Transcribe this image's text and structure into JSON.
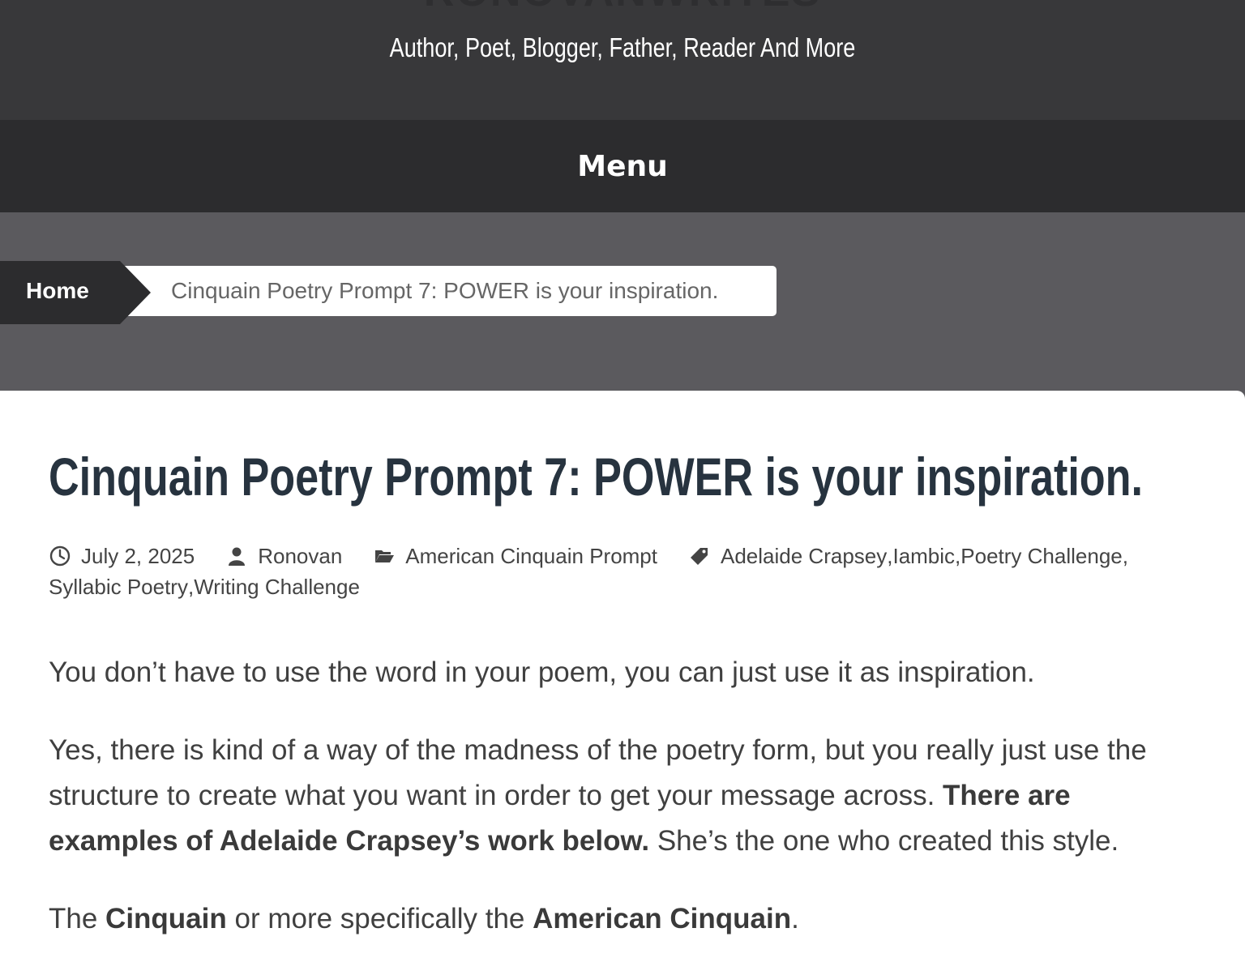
{
  "header": {
    "site_title": "RONOVANWRITES",
    "tagline": "Author, Poet, Blogger, Father, Reader And More"
  },
  "menu": {
    "label": "Menu"
  },
  "breadcrumb": {
    "home": "Home",
    "current": "Cinquain Poetry Prompt 7: POWER is your inspiration."
  },
  "post": {
    "title": "Cinquain Poetry Prompt 7: POWER is your inspiration.",
    "meta": {
      "date": "July 2, 2025",
      "author": "Ronovan",
      "category": "American Cinquain Prompt",
      "tags": [
        "Adelaide Crapsey",
        "Iambic",
        "Poetry Challenge",
        "Syllabic Poetry",
        "Writing Challenge"
      ],
      "icons": [
        "clock-icon",
        "user-icon",
        "folder-icon",
        "tag-icon"
      ]
    },
    "paragraphs": {
      "p1": "You don’t have to use the word in your poem, you can just use it as inspiration.",
      "p2_a": "Yes, there is kind of a way of the madness of the poetry form, but you really just use the structure to create what you want in order to get your message across. ",
      "p2_bold": "There are examples of Adelaide Crapsey’s work below.",
      "p2_b": " She’s the one who created this style.",
      "p3_a": "The ",
      "p3_bold1": "Cinquain",
      "p3_b": " or more specifically the ",
      "p3_bold2": "American Cinquain",
      "p3_c": "."
    }
  },
  "colors": {
    "header_bg": "#38383a",
    "menu_bg": "#2c2c2e",
    "breadcrumb_bg": "#5b5a5e",
    "title_color": "#27333f",
    "text_color": "#404040"
  }
}
